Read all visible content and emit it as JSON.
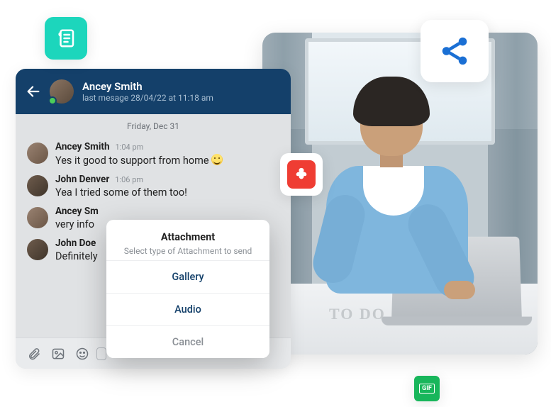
{
  "tiles": {
    "doc_icon": "document-icon",
    "share_icon": "share-icon",
    "pdf_icon": "pdf-icon",
    "gif_label": "GIF"
  },
  "chat": {
    "header": {
      "name": "Ancey Smith",
      "subtitle": "last mesage 28/04/22 at 11:18 am"
    },
    "date_separator": "Friday, Dec 31",
    "messages": [
      {
        "name": "Ancey Smith",
        "time": "1:04 pm",
        "text": "Yes it good to support from home",
        "emoji": true
      },
      {
        "name": "John Denver",
        "time": "1:06 pm",
        "text": "Yea I tried some of them too!",
        "emoji": false
      },
      {
        "name": "Ancey Sm",
        "time": "",
        "text": "very info",
        "emoji": false
      },
      {
        "name": "John Doe",
        "time": "",
        "text": "Definitely",
        "emoji": false
      }
    ],
    "input_placeholder": ""
  },
  "modal": {
    "title": "Attachment",
    "subtitle": "Select type of Attachment to send",
    "options": [
      "Gallery",
      "Audio"
    ],
    "cancel": "Cancel"
  },
  "photo": {
    "todo_text": "TO DO"
  }
}
